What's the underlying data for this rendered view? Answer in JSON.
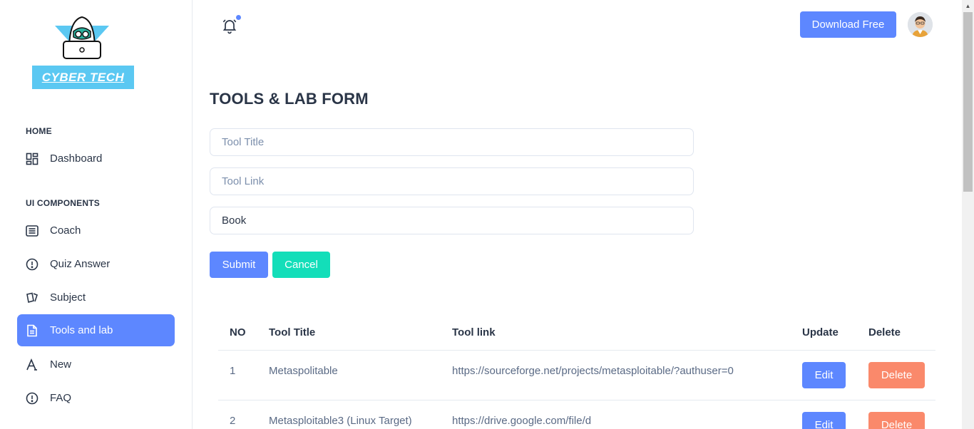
{
  "brand": {
    "name": "CYBER TECH"
  },
  "sidebar": {
    "sections": [
      {
        "caption": "HOME"
      },
      {
        "caption": "UI COMPONENTS"
      }
    ],
    "items": [
      {
        "label": "Dashboard",
        "icon": "layout-dashboard-icon"
      },
      {
        "label": "Coach",
        "icon": "article-icon"
      },
      {
        "label": "Quiz Answer",
        "icon": "alert-circle-icon"
      },
      {
        "label": "Subject",
        "icon": "cards-icon"
      },
      {
        "label": "Tools and lab",
        "icon": "file-description-icon",
        "active": true
      },
      {
        "label": "New",
        "icon": "typography-icon"
      },
      {
        "label": "FAQ",
        "icon": "alert-circle-icon"
      }
    ]
  },
  "header": {
    "download_label": "Download Free",
    "notification_icon": "bell-ringing-icon"
  },
  "form": {
    "title": "TOOLS & LAB FORM",
    "tool_title_placeholder": "Tool Title",
    "tool_link_placeholder": "Tool Link",
    "book_value": "Book",
    "submit_label": "Submit",
    "cancel_label": "Cancel"
  },
  "table": {
    "headers": [
      "NO",
      "Tool Title",
      "Tool link",
      "Update",
      "Delete"
    ],
    "rows": [
      {
        "no": "1",
        "title": "Metaspolitable",
        "link": "https://sourceforge.net/projects/metasploitable/?authuser=0",
        "edit": "Edit",
        "delete": "Delete"
      },
      {
        "no": "2",
        "title": "Metasploitable3 (Linux Target)",
        "link": "https://drive.google.com/file/d",
        "edit": "Edit",
        "delete": "Delete"
      }
    ]
  },
  "colors": {
    "primary": "#5d87ff",
    "success": "#13deb9",
    "danger": "#fa896b",
    "brand_banner": "#5bc8f2"
  }
}
